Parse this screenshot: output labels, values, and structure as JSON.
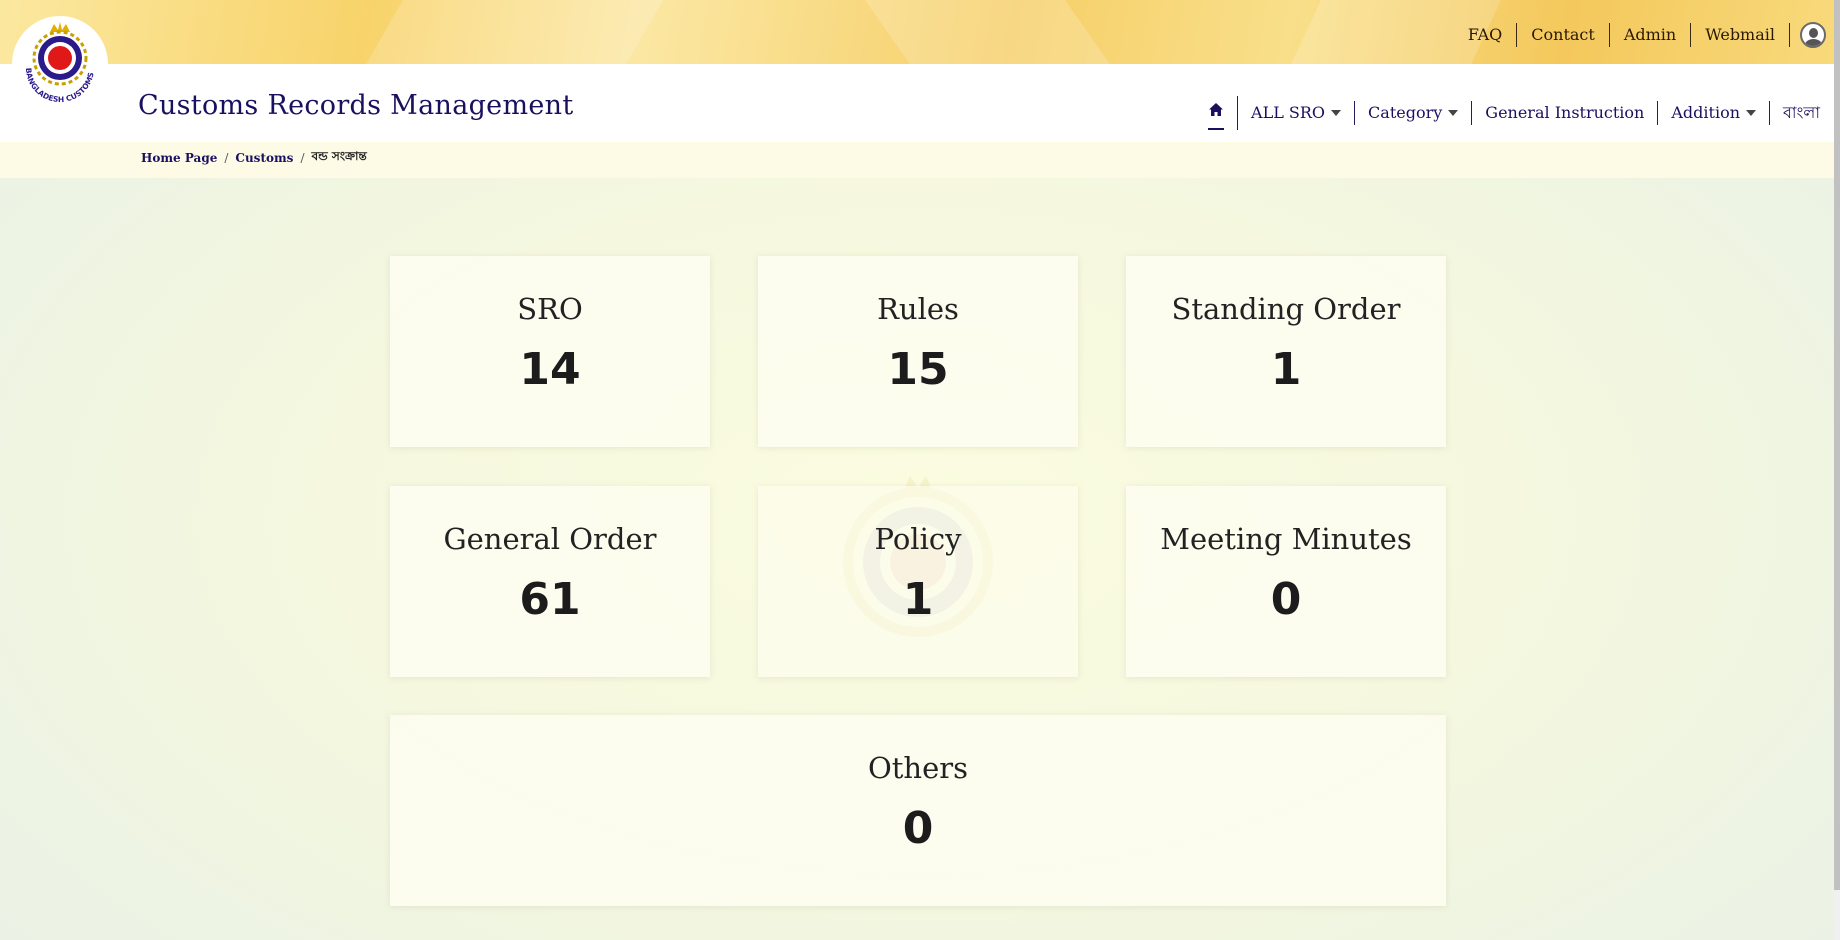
{
  "header": {
    "links": [
      "FAQ",
      "Contact",
      "Admin",
      "Webmail"
    ],
    "site_title": "Customs Records Management"
  },
  "nav": {
    "items": [
      {
        "label": "ALL SRO",
        "dropdown": true
      },
      {
        "label": "Category",
        "dropdown": true
      },
      {
        "label": "General Instruction",
        "dropdown": false
      },
      {
        "label": "Addition",
        "dropdown": true
      },
      {
        "label": "বাংলা",
        "dropdown": false
      }
    ]
  },
  "breadcrumb": {
    "items": [
      "Home Page",
      "Customs",
      "বন্ড সংক্রান্ত"
    ]
  },
  "logo_text": "BANGLADESH CUSTOMS & VAT",
  "cards": [
    {
      "label": "SRO",
      "count": "14"
    },
    {
      "label": "Rules",
      "count": "15"
    },
    {
      "label": "Standing Order",
      "count": "1"
    },
    {
      "label": "General Order",
      "count": "61"
    },
    {
      "label": "Policy",
      "count": "1"
    },
    {
      "label": "Meeting Minutes",
      "count": "0"
    },
    {
      "label": "Others",
      "count": "0"
    }
  ],
  "colors": {
    "title": "#1a1060",
    "banner": "#f8d36a",
    "logo_ring": "#2a1a8a",
    "logo_center": "#e01818"
  }
}
